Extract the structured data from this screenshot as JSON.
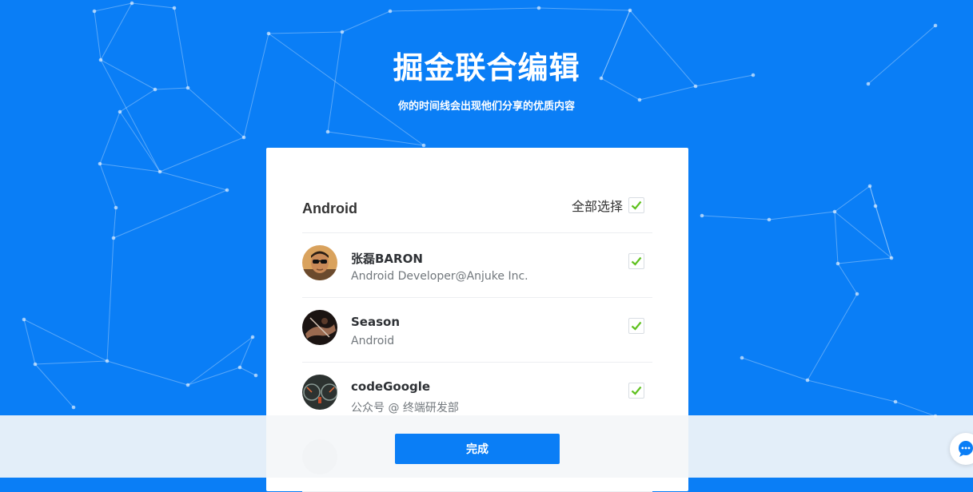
{
  "header": {
    "title": "掘金联合编辑",
    "subtitle": "你的时间线会出现他们分享的优质内容"
  },
  "group": {
    "name": "Android",
    "select_all_label": "全部选择",
    "select_all_checked": true
  },
  "users": [
    {
      "name": "张磊BARON",
      "desc": "Android Developer@Anjuke Inc.",
      "checked": true,
      "avatar_icon": "sunglasses-man-avatar"
    },
    {
      "name": "Season",
      "desc": "Android",
      "checked": true,
      "avatar_icon": "hand-photo-avatar"
    },
    {
      "name": "codeGoogle",
      "desc": "公众号 @ 终端研发部",
      "checked": true,
      "avatar_icon": "dashboard-avatar"
    }
  ],
  "footer": {
    "done_label": "完成"
  },
  "colors": {
    "brand_blue": "#0a7ef6",
    "check_green": "#5fc11f"
  },
  "icons": {
    "check": "checkmark-icon",
    "chat": "chat-bubble-icon"
  }
}
